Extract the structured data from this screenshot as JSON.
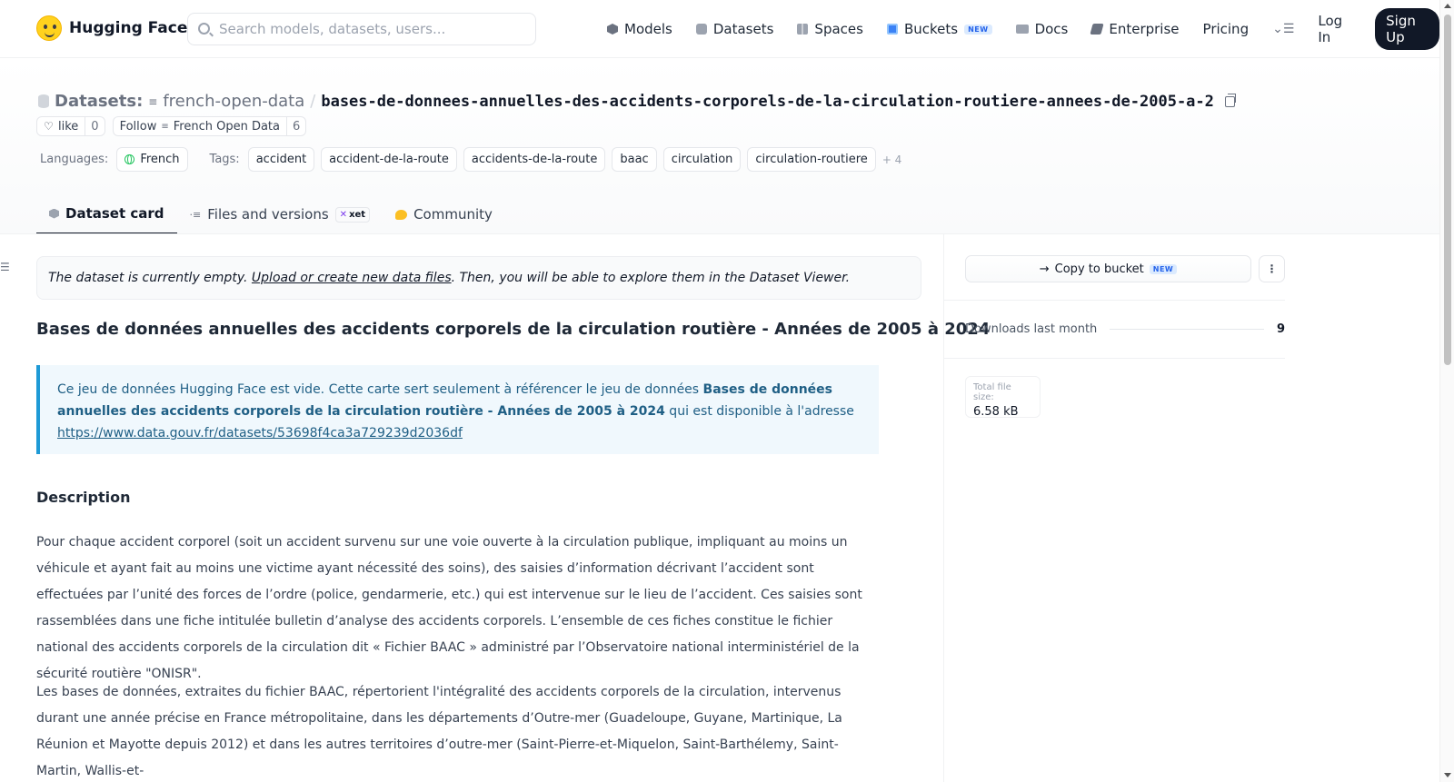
{
  "brand": {
    "name": "Hugging Face",
    "logo_icon": "hugging-face-logo",
    "color": "#ffd21e"
  },
  "search": {
    "placeholder": "Search models, datasets, users..."
  },
  "nav": {
    "items": [
      {
        "label": "Models",
        "icon": "cube-icon"
      },
      {
        "label": "Datasets",
        "icon": "database-icon"
      },
      {
        "label": "Spaces",
        "icon": "grid-icon"
      },
      {
        "label": "Buckets",
        "icon": "bucket-icon",
        "badge": "NEW"
      },
      {
        "label": "Docs",
        "icon": "book-icon"
      },
      {
        "label": "Enterprise",
        "icon": "enterprise-icon"
      },
      {
        "label": "Pricing"
      }
    ],
    "login": "Log In",
    "signup": "Sign Up"
  },
  "breadcrumb": {
    "section": "Datasets:",
    "org": "french-open-data",
    "separator": "/",
    "repo": "bases-de-donnees-annuelles-des-accidents-corporels-de-la-circulation-routiere-annees-de-2005-a-2"
  },
  "actions": {
    "like_label": "like",
    "like_count": "0",
    "follow_label": "Follow",
    "follow_org": "French Open Data",
    "follow_count": "6"
  },
  "metadata": {
    "languages_label": "Languages:",
    "language": "French",
    "tags_label": "Tags:",
    "tags": [
      "accident",
      "accident-de-la-route",
      "accidents-de-la-route",
      "baac",
      "circulation",
      "circulation-routiere"
    ],
    "more_tags": "+ 4"
  },
  "tabs": [
    {
      "label": "Dataset card",
      "active": true
    },
    {
      "label": "Files and versions",
      "badge": "xet"
    },
    {
      "label": "Community"
    }
  ],
  "notice": {
    "before": "The dataset is currently empty. ",
    "link": "Upload or create new data files",
    "after": ". Then, you will be able to explore them in the Dataset Viewer."
  },
  "card": {
    "title": "Bases de données annuelles des accidents corporels de la circulation routière - Années de 2005 à 2024",
    "callout_intro": "Ce jeu de données Hugging Face est vide. Cette carte sert seulement à référencer le jeu de données ",
    "callout_bold": "Bases de données annuelles des accidents corporels de la circulation routière - Années de 2005 à 2024",
    "callout_mid": " qui est disponible à l'adresse ",
    "callout_url": "https://www.data.gouv.fr/datasets/53698f4ca3a729239d2036df",
    "description_heading": "Description",
    "para1": "Pour chaque accident corporel (soit un accident survenu sur une voie ouverte à la circulation publique, impliquant au moins un véhicule et ayant fait au moins une victime ayant nécessité des soins), des saisies d’information décrivant l’accident sont effectuées par l’unité des forces de l’ordre (police, gendarmerie, etc.) qui est intervenue sur le lieu de l’accident. Ces saisies sont rassemblées dans une fiche intitulée bulletin d’analyse des accidents corporels. L’ensemble de ces fiches constitue le fichier national des accidents corporels de la circulation dit « Fichier BAAC » administré par l’Observatoire national interministériel de la sécurité routière \"ONISR\".",
    "para2": "Les bases de données, extraites du fichier BAAC, répertorient l'intégralité des accidents corporels de la circulation, intervenus durant une année précise en France métropolitaine, dans les départements d’Outre-mer (Guadeloupe, Guyane, Martinique, La Réunion et Mayotte depuis 2012) et dans les autres territoires d’outre-mer (Saint-Pierre-et-Miquelon, Saint-Barthélemy, Saint-Martin, Wallis-et-"
  },
  "sidebar": {
    "copy_bucket": "Copy to bucket",
    "copy_badge": "NEW",
    "downloads_label": "Downloads last month",
    "downloads_value": "9",
    "filesize_label": "Total file size:",
    "filesize_value": "6.58 kB"
  }
}
